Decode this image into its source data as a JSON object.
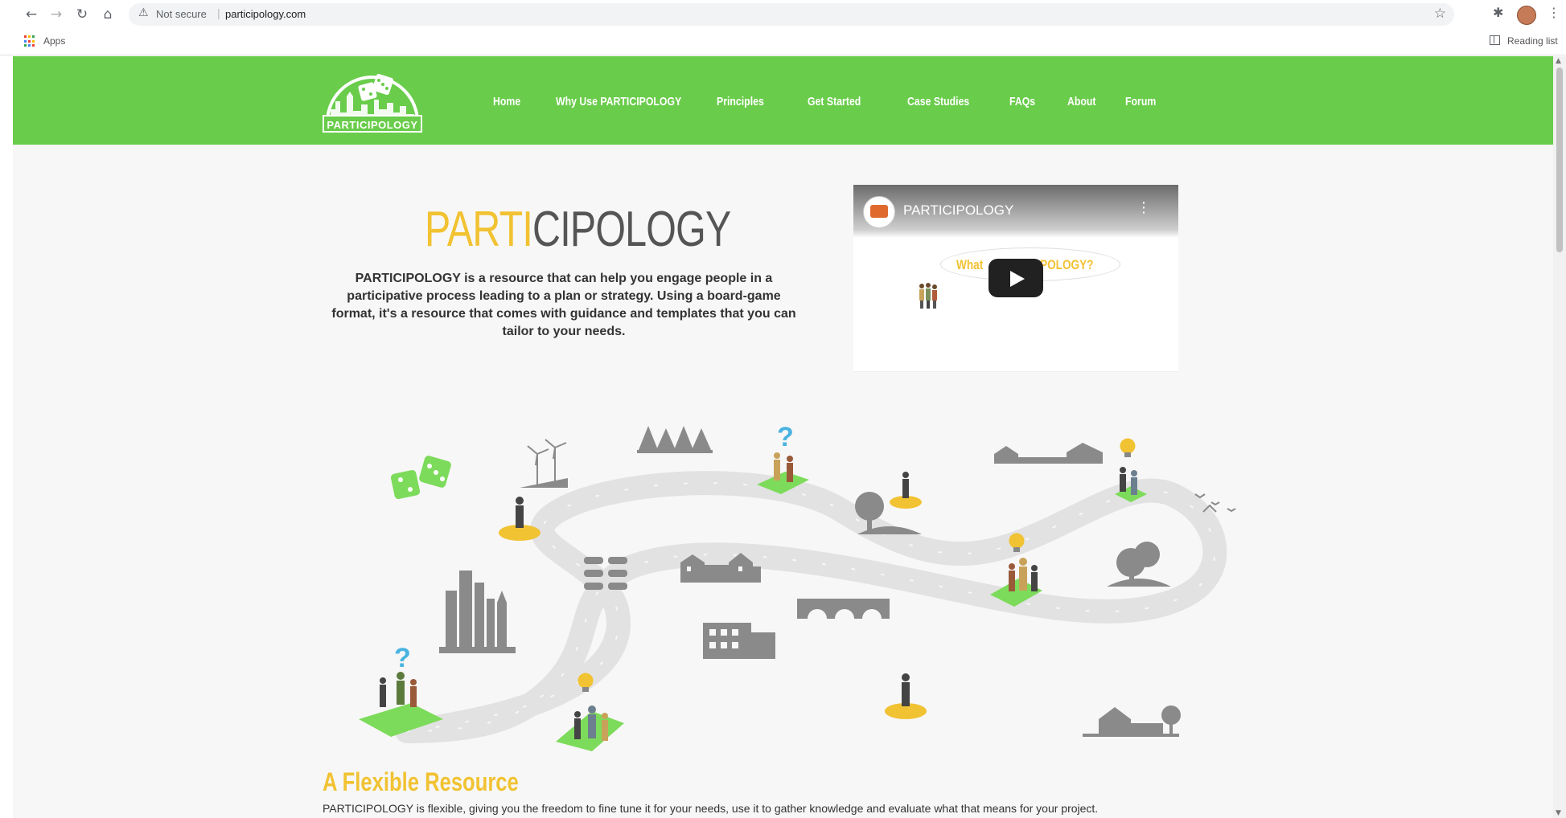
{
  "browser": {
    "back_icon": "←",
    "forward_icon": "→",
    "reload_icon": "↻",
    "home_icon": "⌂",
    "security_icon": "⚠",
    "security_label": "Not secure",
    "separator": "|",
    "url": "participology.com",
    "star_icon": "☆",
    "extension_icon": "✱",
    "menu_icon": "⋮",
    "bookmarks": {
      "apps_label": "Apps",
      "reading_list_label": "Reading list"
    }
  },
  "site": {
    "brand_color": "#69cc4a",
    "accent_color": "#f1c232",
    "logo_text": "PARTICIPOLOGY",
    "nav": [
      {
        "label": "Home"
      },
      {
        "label": "Why Use PARTICIPOLOGY"
      },
      {
        "label": "Principles"
      },
      {
        "label": "Get Started"
      },
      {
        "label": "Case Studies"
      },
      {
        "label": "FAQs"
      },
      {
        "label": "About"
      },
      {
        "label": "Forum"
      }
    ],
    "hero": {
      "title_part1": "PARTI",
      "title_part2": "CIPOLOGY",
      "description": "PARTICIPOLOGY is a resource that can help you engage people in a participative process leading to a plan or strategy. Using a board-game format, it's a resource that comes with guidance and templates that you can tailor to your needs."
    },
    "video": {
      "channel_title": "PARTICIPOLOGY",
      "menu_icon": "⋮",
      "bubble_left": "What",
      "bubble_right": "POLOGY?"
    },
    "board": {
      "question_mark": "?",
      "path_color": "#e6e6e6",
      "tile_color": "#7ddb5b",
      "spot_color": "#f1c232",
      "silhouette_color": "#8a8a8a"
    },
    "flexible": {
      "title": "A Flexible Resource",
      "text": "PARTICIPOLOGY is flexible, giving you the freedom to fine tune it for your needs, use it to gather knowledge and evaluate what that means for your project."
    }
  }
}
